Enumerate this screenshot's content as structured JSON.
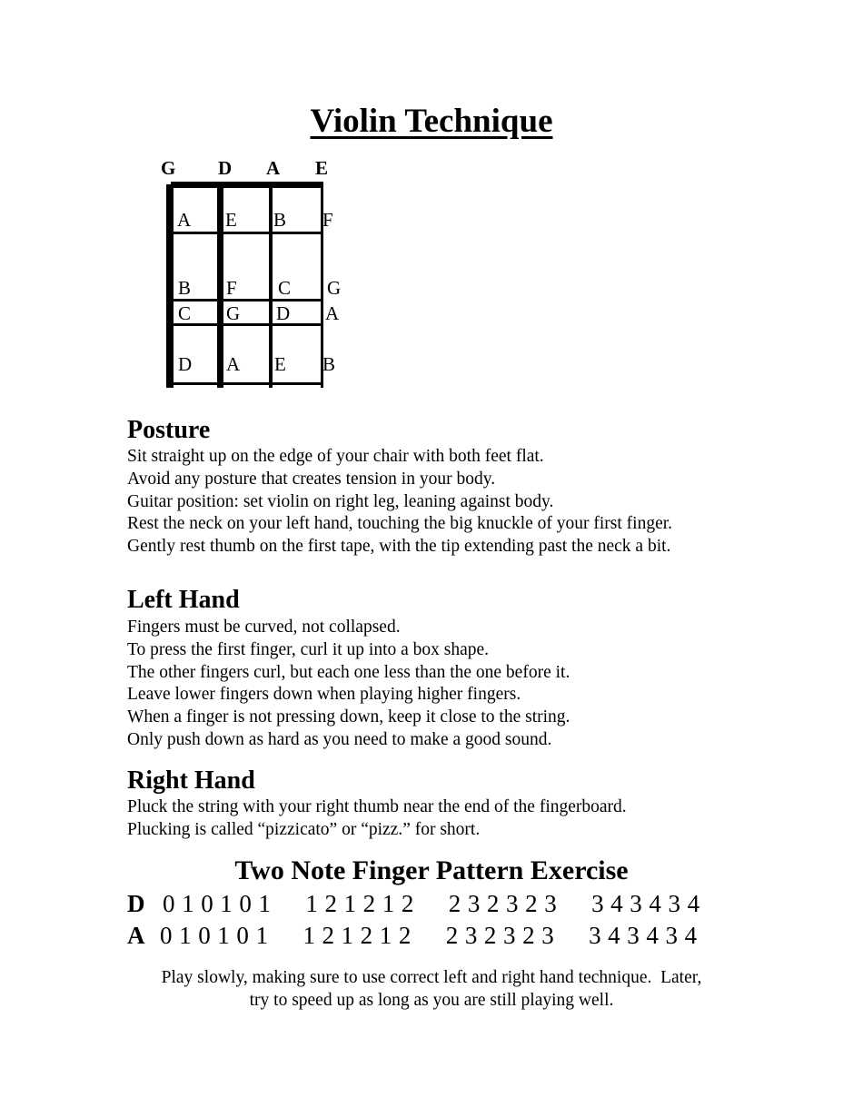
{
  "title": "Violin Technique",
  "fingerboard": {
    "strings": [
      "G",
      "D",
      "A",
      "E"
    ],
    "rows": [
      [
        "A",
        "E",
        "B",
        "F"
      ],
      [
        "B",
        "F",
        "C",
        "G"
      ],
      [
        "C",
        "G",
        "D",
        "A"
      ],
      [
        "D",
        "A",
        "E",
        "B"
      ]
    ]
  },
  "sections": [
    {
      "heading": "Posture",
      "lines": [
        "Sit straight up on the edge of your chair with both feet flat.",
        "Avoid any posture that creates tension in your body.",
        "Guitar position: set violin on right leg, leaning against body.",
        "Rest the neck on your left hand, touching the big knuckle of your first finger.",
        "Gently rest thumb on the first tape, with the tip extending past the neck a bit."
      ]
    },
    {
      "heading": "Left Hand",
      "lines": [
        "Fingers must be curved, not collapsed.",
        "To press the first finger, curl it up into a box shape.",
        "The other fingers curl, but each one less than the one before it.",
        "Leave lower fingers down when playing higher fingers.",
        "When a finger is not pressing down, keep it close to the string.",
        "Only push down as hard as you need to make a good sound."
      ]
    },
    {
      "heading": "Right Hand",
      "lines": [
        "Pluck the string with your right thumb near the end of the fingerboard.",
        "Plucking is called “pizzicato” or “pizz.” for short."
      ]
    }
  ],
  "exercise": {
    "title": "Two Note Finger Pattern Exercise",
    "rows": [
      {
        "string": "D",
        "groups": [
          "010101",
          "121212",
          "232323",
          "343434"
        ]
      },
      {
        "string": "A",
        "groups": [
          "010101",
          "121212",
          "232323",
          "343434"
        ]
      }
    ],
    "instructions": [
      "Play slowly, making sure to use correct left and right hand technique.  Later,",
      "try to speed up as long as you are still playing well."
    ]
  }
}
